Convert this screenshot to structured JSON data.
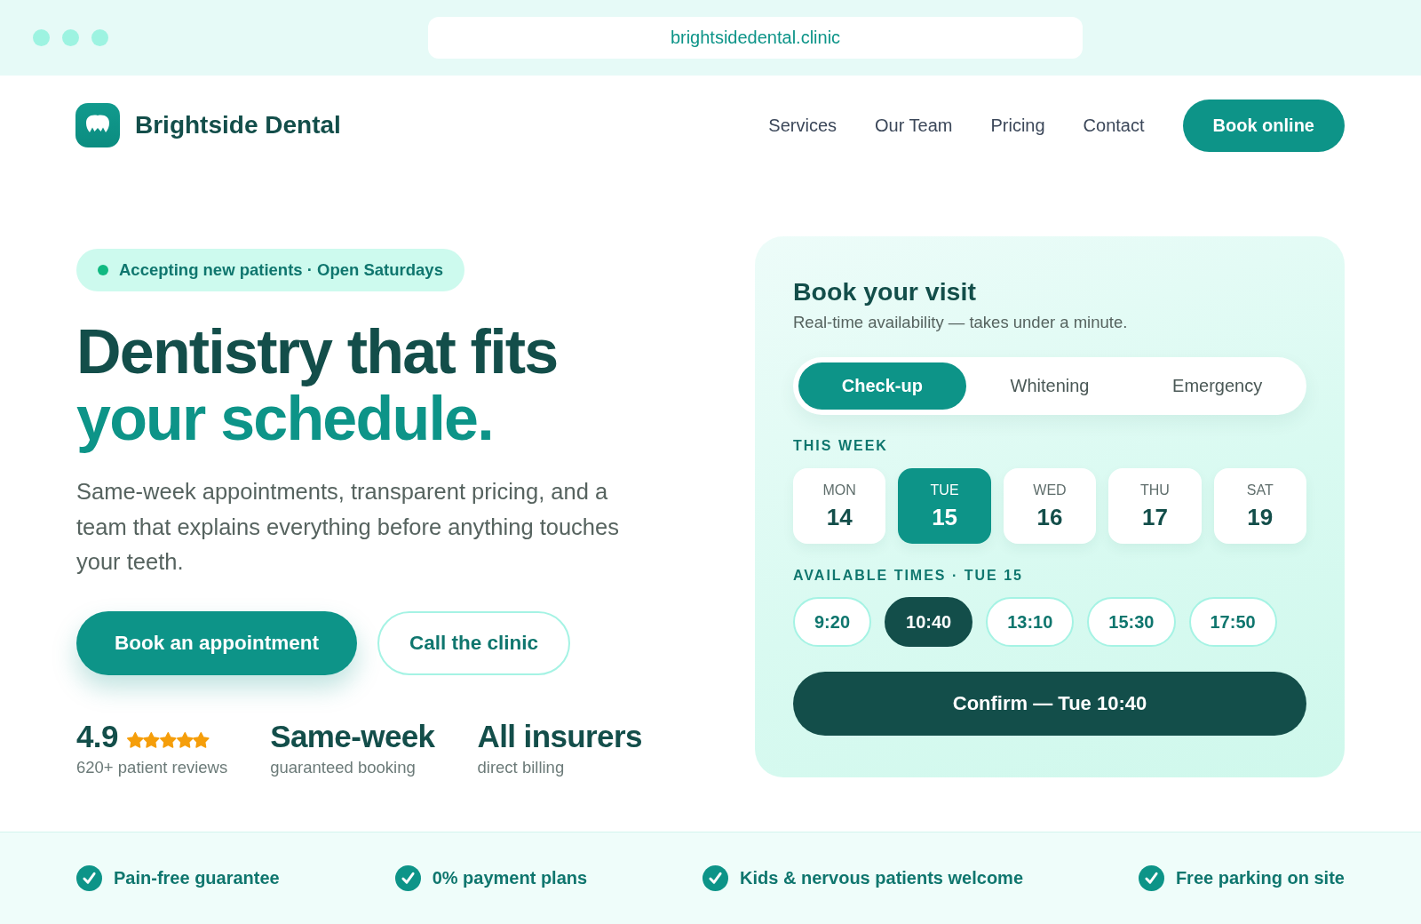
{
  "browser": {
    "url": "brightsidedental.clinic"
  },
  "header": {
    "brand": "Brightside Dental",
    "nav": [
      "Services",
      "Our Team",
      "Pricing",
      "Contact"
    ],
    "cta": "Book online"
  },
  "hero": {
    "badge": "Accepting new patients · Open Saturdays",
    "headline": {
      "text": "Dentistry that fits",
      "highlight": "your schedule."
    },
    "description": "Same-week appointments, transparent pricing, and a team that explains everything before anything touches your teeth.",
    "buttons": [
      {
        "label": "Book an appointment",
        "kind": "primary"
      },
      {
        "label": "Call the clinic",
        "kind": "secondary"
      }
    ],
    "stats": [
      {
        "value": "4.9",
        "stars": 5,
        "caption": "620+ patient reviews"
      },
      {
        "value": "Same-week",
        "caption": "guaranteed booking"
      },
      {
        "value": "All insurers",
        "caption": "direct billing"
      }
    ]
  },
  "booking": {
    "title": "Book your visit",
    "subtitle": "Real-time availability — takes under a minute.",
    "services": [
      {
        "label": "Check-up",
        "selected": true
      },
      {
        "label": "Whitening",
        "selected": false
      },
      {
        "label": "Emergency",
        "selected": false
      }
    ],
    "week_label": "THIS WEEK",
    "days": [
      {
        "weekday": "MON",
        "date": "14",
        "selected": false
      },
      {
        "weekday": "TUE",
        "date": "15",
        "selected": true
      },
      {
        "weekday": "WED",
        "date": "16",
        "selected": false
      },
      {
        "weekday": "THU",
        "date": "17",
        "selected": false
      },
      {
        "weekday": "SAT",
        "date": "19",
        "selected": false
      }
    ],
    "times_label": "AVAILABLE TIMES · TUE 15",
    "times": [
      {
        "label": "9:20",
        "selected": false
      },
      {
        "label": "10:40",
        "selected": true
      },
      {
        "label": "13:10",
        "selected": false
      },
      {
        "label": "15:30",
        "selected": false
      },
      {
        "label": "17:50",
        "selected": false
      }
    ],
    "confirm": "Confirm — Tue 10:40"
  },
  "features": [
    "Pain-free guarantee",
    "0% payment plans",
    "Kids & nervous patients welcome",
    "Free parking on site"
  ]
}
